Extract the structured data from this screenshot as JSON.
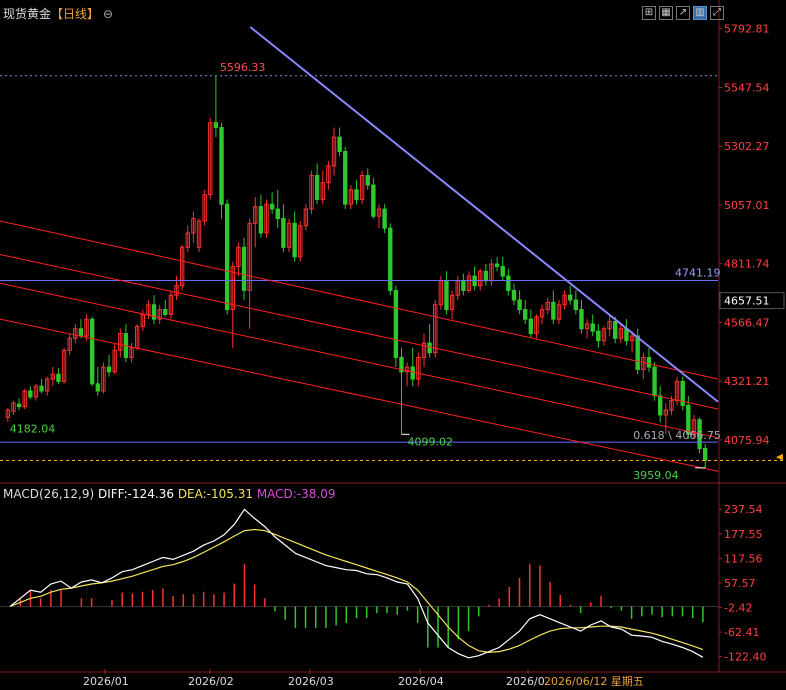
{
  "header": {
    "title": "现货黄金",
    "period": "【日线】",
    "circle_icon": "circle-minus-icon",
    "tools": [
      {
        "name": "crosshair-icon",
        "glyph": "⊞",
        "active": false
      },
      {
        "name": "grid-icon",
        "glyph": "▦",
        "active": false
      },
      {
        "name": "draw-icon",
        "glyph": "↗",
        "active": false
      },
      {
        "name": "indicator-icon",
        "glyph": "▥",
        "active": true
      },
      {
        "name": "fullscreen-icon",
        "glyph": "⤢",
        "active": false
      }
    ]
  },
  "macd_header": {
    "label": "MACD(26,12,9)",
    "diff": "DIFF:-124.36",
    "dea": "DEA:-105.31",
    "macd": "MACD:-38.09"
  },
  "colors": {
    "up": "#ff3030",
    "down": "#2ec82e",
    "diff": "#ffffff",
    "dea": "#f5e35a",
    "trend_blue": "#8888ff",
    "channel_red": "#ff2020",
    "hline_blue": "#6c6cff",
    "current": "#ffa500"
  },
  "chart_data": {
    "type": "candlestick",
    "symbol": "现货黄金",
    "period": "日线",
    "price_axis": {
      "min": 3900,
      "max": 5800,
      "tick_labels": [
        "5792.81",
        "5547.54",
        "5302.27",
        "5057.01",
        "4811.74",
        "4566.47",
        "4321.21",
        "4075.94"
      ],
      "current_price": "4657.51"
    },
    "date_axis": {
      "labels": [
        "2026/01",
        "2026/02",
        "2026/03",
        "2026/04",
        "2026/0"
      ],
      "cursor_label": "2026/06/12 星期五"
    },
    "annotations": {
      "high": "5596.33",
      "low_march": "4099.02",
      "start": "4182.04",
      "low_recent": "3959.04",
      "fib": "0.618 \\ 4066.75",
      "hline": "4741.19"
    },
    "candles": [
      [
        4170,
        4210,
        4150,
        4200
      ],
      [
        4195,
        4240,
        4180,
        4230
      ],
      [
        4225,
        4250,
        4200,
        4215
      ],
      [
        4215,
        4290,
        4205,
        4280
      ],
      [
        4280,
        4300,
        4245,
        4255
      ],
      [
        4255,
        4310,
        4240,
        4300
      ],
      [
        4300,
        4330,
        4270,
        4280
      ],
      [
        4280,
        4340,
        4260,
        4330
      ],
      [
        4330,
        4380,
        4300,
        4350
      ],
      [
        4350,
        4375,
        4310,
        4320
      ],
      [
        4320,
        4460,
        4310,
        4450
      ],
      [
        4450,
        4520,
        4430,
        4500
      ],
      [
        4500,
        4560,
        4480,
        4540
      ],
      [
        4540,
        4580,
        4500,
        4510
      ],
      [
        4510,
        4600,
        4490,
        4580
      ],
      [
        4580,
        4590,
        4300,
        4310
      ],
      [
        4310,
        4380,
        4260,
        4280
      ],
      [
        4280,
        4400,
        4270,
        4380
      ],
      [
        4380,
        4430,
        4340,
        4360
      ],
      [
        4360,
        4480,
        4350,
        4450
      ],
      [
        4450,
        4540,
        4420,
        4520
      ],
      [
        4520,
        4560,
        4400,
        4420
      ],
      [
        4420,
        4480,
        4400,
        4460
      ],
      [
        4460,
        4560,
        4450,
        4550
      ],
      [
        4550,
        4620,
        4530,
        4600
      ],
      [
        4600,
        4660,
        4580,
        4640
      ],
      [
        4640,
        4680,
        4560,
        4580
      ],
      [
        4580,
        4640,
        4560,
        4620
      ],
      [
        4620,
        4660,
        4590,
        4600
      ],
      [
        4600,
        4700,
        4580,
        4680
      ],
      [
        4680,
        4760,
        4660,
        4720
      ],
      [
        4720,
        4890,
        4700,
        4880
      ],
      [
        4880,
        4970,
        4860,
        4940
      ],
      [
        4940,
        5030,
        4900,
        5000
      ],
      [
        4880,
        5000,
        4860,
        4990
      ],
      [
        4990,
        5120,
        4970,
        5100
      ],
      [
        5100,
        5420,
        5080,
        5400
      ],
      [
        5400,
        5596,
        5340,
        5380
      ],
      [
        5380,
        5400,
        5000,
        5060
      ],
      [
        5060,
        5080,
        4600,
        4620
      ],
      [
        4620,
        4820,
        4460,
        4800
      ],
      [
        4800,
        4900,
        4760,
        4880
      ],
      [
        4880,
        4920,
        4660,
        4700
      ],
      [
        4700,
        5000,
        4540,
        4980
      ],
      [
        4980,
        5090,
        4880,
        5050
      ],
      [
        5050,
        5100,
        4920,
        4940
      ],
      [
        4940,
        5080,
        4920,
        5060
      ],
      [
        5060,
        5110,
        5020,
        5040
      ],
      [
        5040,
        5120,
        4960,
        5000
      ],
      [
        5000,
        5060,
        4860,
        4880
      ],
      [
        4880,
        5000,
        4860,
        4980
      ],
      [
        4980,
        5030,
        4820,
        4840
      ],
      [
        4840,
        4990,
        4820,
        4970
      ],
      [
        4970,
        5060,
        4950,
        5040
      ],
      [
        5040,
        5200,
        5020,
        5180
      ],
      [
        5180,
        5230,
        5060,
        5080
      ],
      [
        5080,
        5200,
        5060,
        5150
      ],
      [
        5150,
        5240,
        5120,
        5220
      ],
      [
        5220,
        5380,
        5180,
        5340
      ],
      [
        5340,
        5380,
        5260,
        5280
      ],
      [
        5280,
        5300,
        5040,
        5060
      ],
      [
        5060,
        5140,
        5040,
        5120
      ],
      [
        5120,
        5160,
        5060,
        5080
      ],
      [
        5080,
        5200,
        5060,
        5180
      ],
      [
        5180,
        5210,
        5120,
        5140
      ],
      [
        5140,
        5170,
        5000,
        5010
      ],
      [
        5010,
        5060,
        4960,
        5040
      ],
      [
        5040,
        5060,
        4940,
        4960
      ],
      [
        4960,
        4980,
        4680,
        4700
      ],
      [
        4700,
        4720,
        4380,
        4420
      ],
      [
        4420,
        4460,
        4100,
        4360
      ],
      [
        4360,
        4400,
        4300,
        4380
      ],
      [
        4380,
        4460,
        4300,
        4330
      ],
      [
        4330,
        4440,
        4300,
        4420
      ],
      [
        4420,
        4520,
        4380,
        4480
      ],
      [
        4480,
        4560,
        4420,
        4440
      ],
      [
        4440,
        4660,
        4420,
        4640
      ],
      [
        4640,
        4760,
        4620,
        4740
      ],
      [
        4740,
        4780,
        4600,
        4620
      ],
      [
        4620,
        4700,
        4580,
        4680
      ],
      [
        4680,
        4760,
        4660,
        4740
      ],
      [
        4740,
        4770,
        4680,
        4700
      ],
      [
        4700,
        4780,
        4690,
        4760
      ],
      [
        4760,
        4800,
        4700,
        4720
      ],
      [
        4720,
        4790,
        4700,
        4780
      ],
      [
        4780,
        4810,
        4720,
        4740
      ],
      [
        4740,
        4830,
        4720,
        4810
      ],
      [
        4810,
        4840,
        4780,
        4800
      ],
      [
        4800,
        4840,
        4740,
        4760
      ],
      [
        4760,
        4790,
        4680,
        4700
      ],
      [
        4700,
        4730,
        4640,
        4660
      ],
      [
        4660,
        4700,
        4600,
        4620
      ],
      [
        4620,
        4660,
        4560,
        4580
      ],
      [
        4580,
        4620,
        4500,
        4520
      ],
      [
        4520,
        4600,
        4500,
        4590
      ],
      [
        4590,
        4640,
        4560,
        4620
      ],
      [
        4620,
        4670,
        4600,
        4650
      ],
      [
        4650,
        4700,
        4560,
        4580
      ],
      [
        4580,
        4660,
        4560,
        4640
      ],
      [
        4640,
        4700,
        4620,
        4680
      ],
      [
        4680,
        4720,
        4640,
        4660
      ],
      [
        4660,
        4700,
        4600,
        4620
      ],
      [
        4620,
        4660,
        4520,
        4540
      ],
      [
        4540,
        4580,
        4500,
        4560
      ],
      [
        4560,
        4600,
        4510,
        4530
      ],
      [
        4530,
        4560,
        4460,
        4490
      ],
      [
        4490,
        4550,
        4470,
        4540
      ],
      [
        4540,
        4600,
        4510,
        4570
      ],
      [
        4570,
        4590,
        4480,
        4500
      ],
      [
        4500,
        4560,
        4480,
        4540
      ],
      [
        4540,
        4580,
        4470,
        4490
      ],
      [
        4490,
        4530,
        4440,
        4510
      ],
      [
        4510,
        4540,
        4350,
        4370
      ],
      [
        4370,
        4440,
        4330,
        4420
      ],
      [
        4420,
        4460,
        4360,
        4380
      ],
      [
        4380,
        4400,
        4240,
        4260
      ],
      [
        4260,
        4300,
        4150,
        4180
      ],
      [
        4180,
        4230,
        4100,
        4200
      ],
      [
        4200,
        4260,
        4180,
        4240
      ],
      [
        4240,
        4340,
        4220,
        4320
      ],
      [
        4320,
        4340,
        4200,
        4220
      ],
      [
        4220,
        4260,
        4080,
        4100
      ],
      [
        4100,
        4180,
        4080,
        4160
      ],
      [
        4160,
        4170,
        4020,
        4040
      ],
      [
        4040,
        4060,
        3959,
        3990
      ]
    ],
    "macd": {
      "diff": [
        0,
        20,
        40,
        35,
        55,
        62,
        45,
        60,
        65,
        58,
        70,
        85,
        90,
        100,
        110,
        120,
        115,
        125,
        135,
        150,
        160,
        175,
        200,
        237,
        215,
        195,
        170,
        150,
        130,
        120,
        110,
        100,
        95,
        90,
        88,
        80,
        78,
        70,
        60,
        55,
        20,
        -40,
        -70,
        -100,
        -115,
        -125,
        -120,
        -110,
        -100,
        -80,
        -60,
        -30,
        -20,
        -30,
        -40,
        -50,
        -60,
        -45,
        -35,
        -50,
        -55,
        -70,
        -72,
        -75,
        -85,
        -92,
        -100,
        -110,
        -124
      ],
      "dea": [
        0,
        10,
        20,
        25,
        35,
        42,
        45,
        50,
        55,
        58,
        62,
        68,
        74,
        82,
        90,
        98,
        102,
        110,
        120,
        132,
        145,
        158,
        172,
        185,
        188,
        185,
        176,
        166,
        156,
        146,
        136,
        126,
        118,
        110,
        102,
        94,
        86,
        78,
        70,
        60,
        40,
        10,
        -20,
        -50,
        -75,
        -95,
        -108,
        -112,
        -110,
        -104,
        -95,
        -82,
        -70,
        -60,
        -54,
        -52,
        -52,
        -50,
        -48,
        -48,
        -50,
        -55,
        -60,
        -65,
        -72,
        -80,
        -88,
        -96,
        -105
      ],
      "hist": [
        0,
        20,
        40,
        20,
        40,
        40,
        0,
        20,
        20,
        0,
        16,
        34,
        32,
        36,
        40,
        44,
        26,
        30,
        30,
        36,
        30,
        34,
        56,
        104,
        54,
        20,
        -12,
        -32,
        -52,
        -52,
        -52,
        -52,
        -46,
        -40,
        -28,
        -28,
        -16,
        -16,
        -20,
        -10,
        -40,
        -100,
        -100,
        -100,
        -80,
        -60,
        -24,
        4,
        20,
        48,
        70,
        104,
        100,
        60,
        28,
        4,
        -16,
        10,
        26,
        -4,
        -10,
        -30,
        -24,
        -20,
        -26,
        -24,
        -24,
        -28,
        -38
      ],
      "axis": {
        "min": -150,
        "max": 260,
        "tick_labels": [
          "237.54",
          "177.55",
          "117.56",
          "57.57",
          "-2.42",
          "-62.41",
          "-122.40"
        ]
      }
    }
  }
}
